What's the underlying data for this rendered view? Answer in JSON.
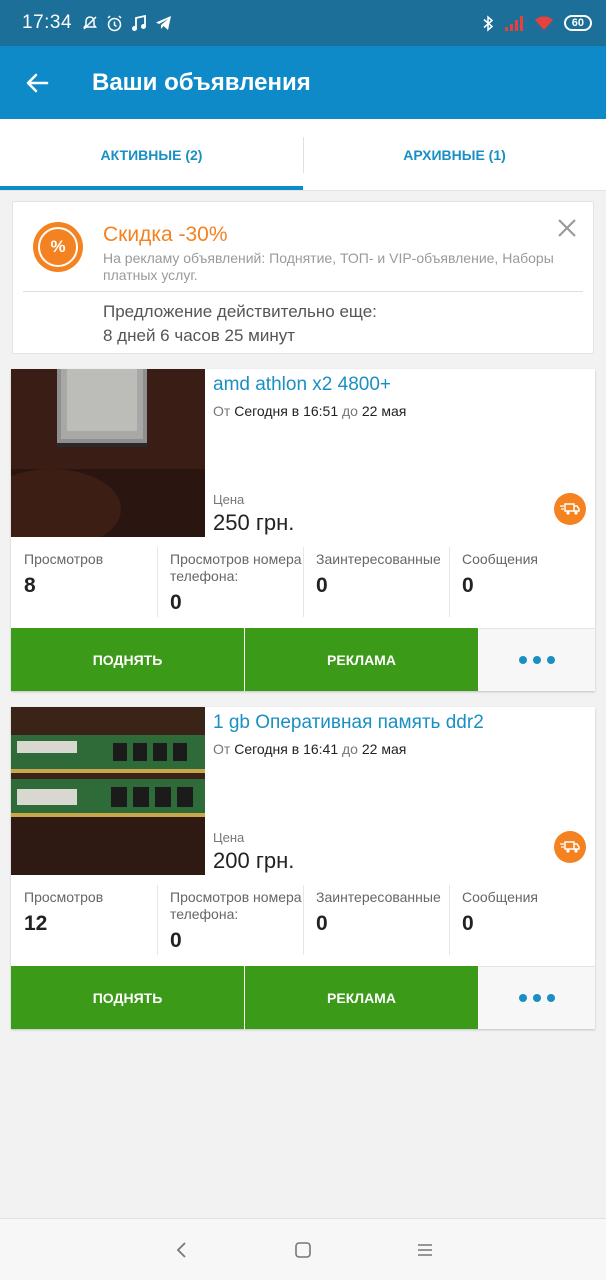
{
  "status_bar": {
    "time": "17:34",
    "battery": "60",
    "left_icons": [
      "mute-icon",
      "alarm-icon",
      "music-icon",
      "telegram-icon"
    ],
    "right_icons": [
      "bluetooth-icon",
      "signal-icon",
      "wifi-icon",
      "battery-icon"
    ]
  },
  "header": {
    "title": "Ваши объявления"
  },
  "tabs": [
    {
      "label": "АКТИВНЫЕ (2)",
      "active": true
    },
    {
      "label": "АРХИВНЫЕ (1)",
      "active": false
    }
  ],
  "promo": {
    "title": "Скидка -30%",
    "description": "На рекламу объявлений: Поднятие, ТОП- и VIP-объявление, Наборы платных услуг.",
    "offer_line1": "Предложение действительно еще:",
    "offer_line2": "8 дней 6 часов 25 минут",
    "icon_text": "%"
  },
  "listings": [
    {
      "title": "amd athlon x2 4800+",
      "from_label": "От",
      "from_value": "Сегодня в 16:51",
      "to_label": "до",
      "to_value": "22 мая",
      "price_label": "Цена",
      "price": "250 грн.",
      "stats": [
        {
          "label": "Просмотров",
          "value": "8"
        },
        {
          "label": "Просмотров номера телефона:",
          "value": "0"
        },
        {
          "label": "Заинтересованные",
          "value": "0"
        },
        {
          "label": "Сообщения",
          "value": "0"
        }
      ],
      "buttons": {
        "raise": "ПОДНЯТЬ",
        "ads": "РЕКЛАМА"
      }
    },
    {
      "title": "1 gb Оперативная память ddr2",
      "from_label": "От",
      "from_value": "Сегодня в 16:41",
      "to_label": "до",
      "to_value": "22 мая",
      "price_label": "Цена",
      "price": "200 грн.",
      "stats": [
        {
          "label": "Просмотров",
          "value": "12"
        },
        {
          "label": "Просмотров номера телефона:",
          "value": "0"
        },
        {
          "label": "Заинтересованные",
          "value": "0"
        },
        {
          "label": "Сообщения",
          "value": "0"
        }
      ],
      "buttons": {
        "raise": "ПОДНЯТЬ",
        "ads": "РЕКЛАМА"
      }
    }
  ],
  "colors": {
    "status_bar": "#1b6f98",
    "app_bar": "#0e8ac8",
    "accent_blue": "#1a8fc4",
    "accent_orange": "#f58220",
    "button_green": "#3b9a17"
  }
}
